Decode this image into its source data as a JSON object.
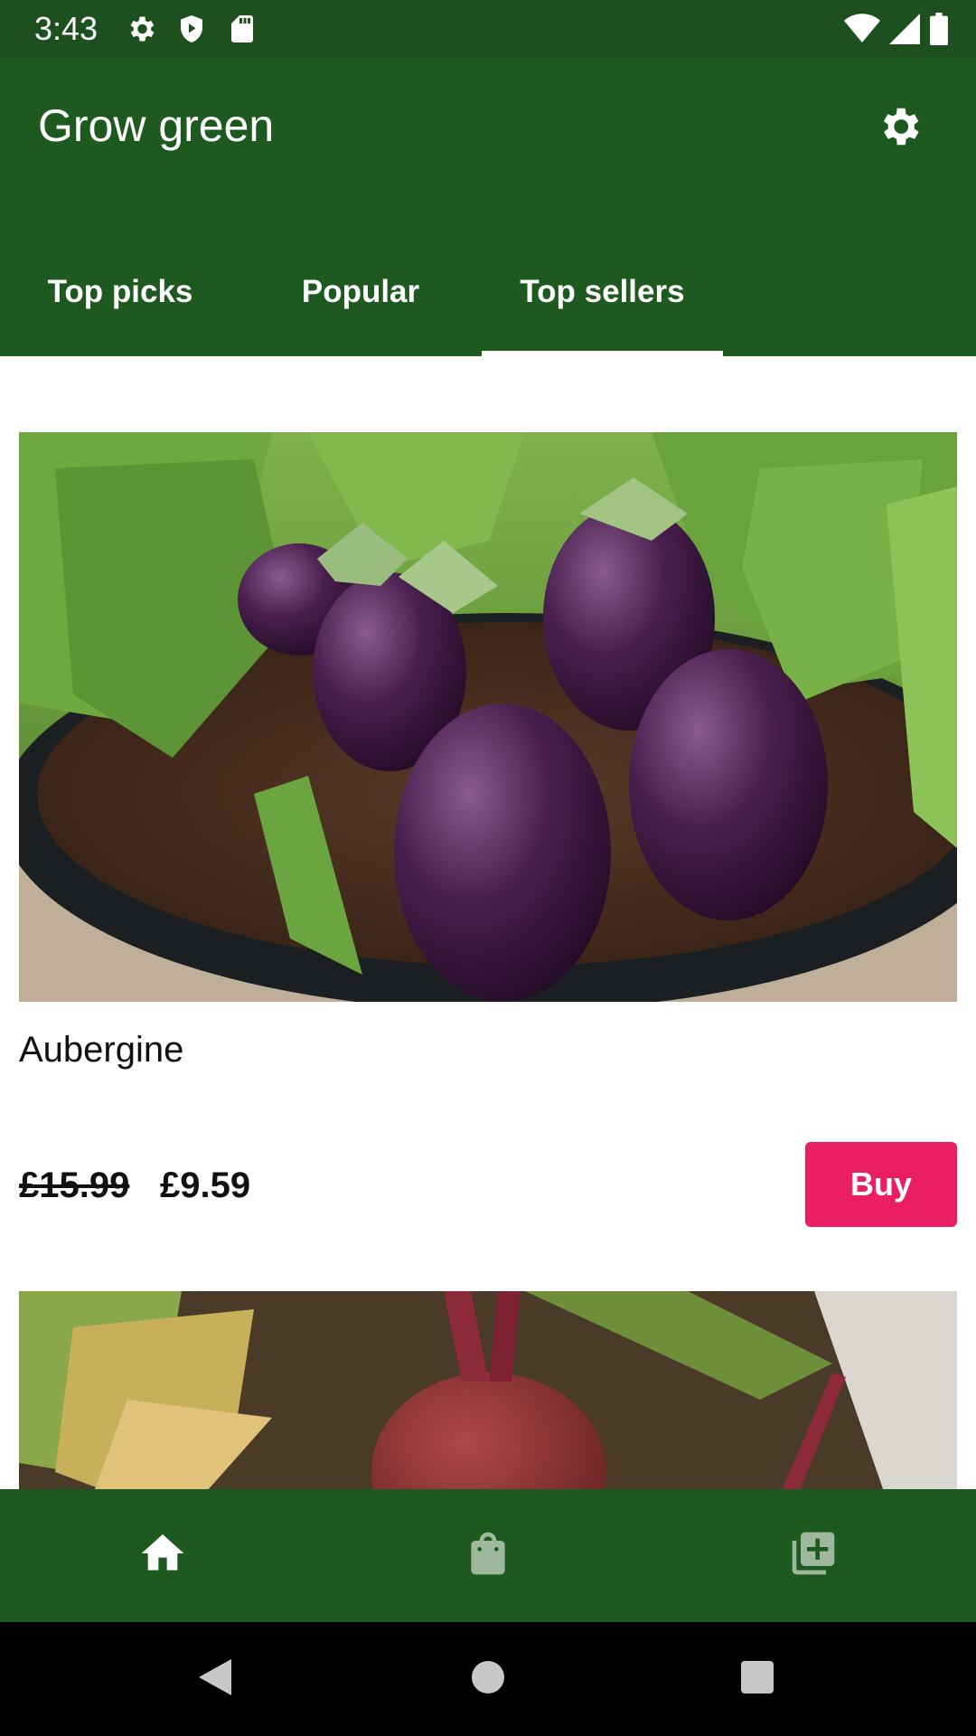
{
  "status_bar": {
    "time": "3:43",
    "icons": [
      "settings-icon",
      "play-protect-icon",
      "sd-card-icon",
      "wifi-icon",
      "signal-icon",
      "battery-icon"
    ]
  },
  "app_bar": {
    "title": "Grow green",
    "settings_icon": "gear-icon"
  },
  "tabs": [
    {
      "label": "Top picks",
      "selected": false
    },
    {
      "label": "Popular",
      "selected": false
    },
    {
      "label": "Top sellers",
      "selected": true
    }
  ],
  "products": [
    {
      "name": "Aubergine",
      "old_price": "£15.99",
      "price": "£9.59",
      "buy_label": "Buy"
    }
  ],
  "bottom_nav": [
    {
      "icon": "home-icon",
      "selected": true
    },
    {
      "icon": "shopping-bag-icon",
      "selected": false
    },
    {
      "icon": "library-add-icon",
      "selected": false
    }
  ],
  "colors": {
    "primary": "#1e5a20",
    "status_bar": "#1d4f1f",
    "accent": "#e91e63"
  }
}
